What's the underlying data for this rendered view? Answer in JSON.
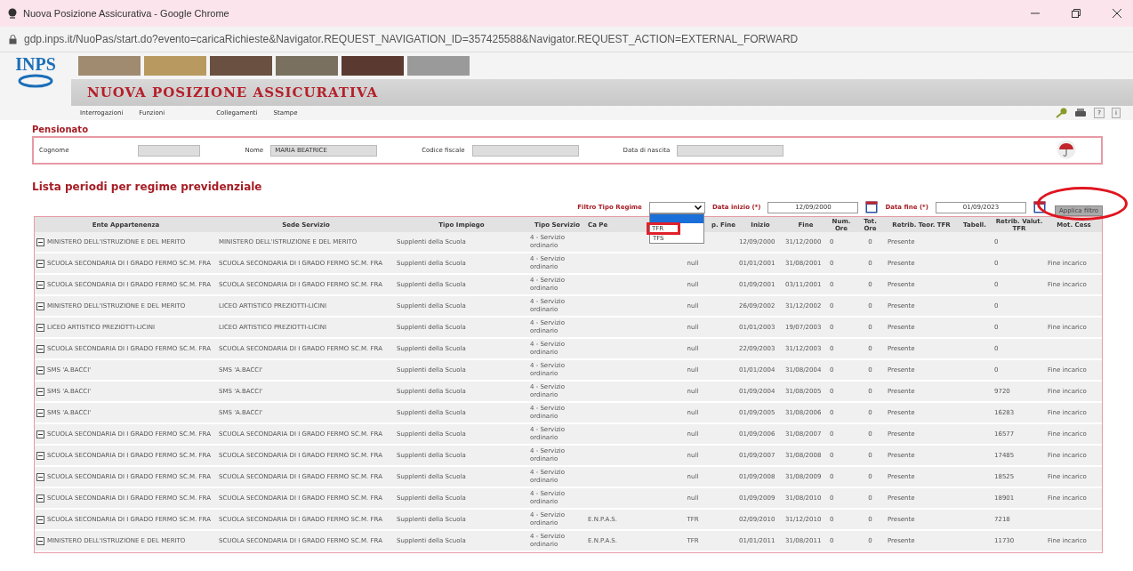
{
  "window": {
    "title": "Nuova Posizione Assicurativa - Google Chrome"
  },
  "address_bar": {
    "url": "gdp.inps.it/NuoPas/start.do?evento=caricaRichieste&Navigator.REQUEST_NAVIGATION_ID=357425588&Navigator.REQUEST_ACTION=EXTERNAL_FORWARD"
  },
  "header": {
    "logo": "INPS",
    "title": "NUOVA POSIZIONE ASSICURATIVA"
  },
  "menu": [
    "Interrogazioni",
    "Funzioni",
    "Collegamenti",
    "Stampe"
  ],
  "toolbar": {
    "help": "?",
    "info": "i"
  },
  "pensionato": {
    "title": "Pensionato",
    "fields": [
      {
        "label": "Cognome"
      },
      {
        "label": "Nome",
        "value": "MARIA BEATRICE"
      },
      {
        "label": "Codice fiscale"
      },
      {
        "label": "Data di nascita"
      }
    ]
  },
  "list_title": "Lista periodi per regime previdenziale",
  "filter": {
    "regime_label": "Filtro Tipo Regime",
    "options": [
      {
        "selected": true
      },
      {
        "label": "TFR",
        "selected": false
      },
      {
        "label": "TFS",
        "selected": false
      }
    ],
    "start_label": "Data inizio (*)",
    "start_value": "12/09/2000",
    "end_label": "Data fine (*)",
    "end_value": "01/09/2023",
    "apply": "Applica filtro"
  },
  "table": {
    "columns": [
      "Ente Appartenenza",
      "Sede Servizio",
      "Tipo Impiego",
      "Tipo Servizio",
      "Ca Pe",
      "p. Fine",
      "Inizio",
      "Fine",
      "Num. Ore",
      "Tot. Ore",
      "Retrib. Teor. TFR",
      "Tabell.",
      "Retrib. Valut. TFR",
      "Mot. Cess"
    ],
    "rows": [
      {
        "ente_appartenenza": "MINISTERO DELL'ISTRUZIONE E DEL MERITO",
        "sede_servizio": "MINISTERO DELL'ISTRUZIONE E DEL MERITO",
        "tipo_impiego": "Supplenti della Scuola",
        "tipo_servizio": "4 - Servizio ordinario",
        "inizio": "12/09/2000",
        "fine": "31/12/2000",
        "num_ore": "0",
        "tot_ore": "0",
        "retrib_teor_tfr": "Presente",
        "retrib_valut_tfr": "0"
      },
      {
        "ente_appartenenza": "SCUOLA SECONDARIA DI I GRADO FERMO SC.M. FRA",
        "sede_servizio": "SCUOLA SECONDARIA DI I GRADO FERMO SC.M. FRA",
        "tipo_impiego": "Supplenti della Scuola",
        "tipo_servizio": "4 - Servizio ordinario",
        "tipo_fine": "null",
        "inizio": "01/01/2001",
        "fine": "31/08/2001",
        "num_ore": "0",
        "tot_ore": "0",
        "retrib_teor_tfr": "Presente",
        "retrib_valut_tfr": "0",
        "mot_cess": "Fine incarico"
      },
      {
        "ente_appartenenza": "SCUOLA SECONDARIA DI I GRADO FERMO SC.M. FRA",
        "sede_servizio": "SCUOLA SECONDARIA DI I GRADO FERMO SC.M. FRA",
        "tipo_impiego": "Supplenti della Scuola",
        "tipo_servizio": "4 - Servizio ordinario",
        "tipo_fine": "null",
        "inizio": "01/09/2001",
        "fine": "03/11/2001",
        "num_ore": "0",
        "tot_ore": "0",
        "retrib_teor_tfr": "Presente",
        "retrib_valut_tfr": "0",
        "mot_cess": "Fine incarico"
      },
      {
        "ente_appartenenza": "MINISTERO DELL'ISTRUZIONE E DEL MERITO",
        "sede_servizio": "LICEO ARTISTICO PREZIOTTI-LICINI",
        "tipo_impiego": "Supplenti della Scuola",
        "tipo_servizio": "4 - Servizio ordinario",
        "tipo_fine": "null",
        "inizio": "26/09/2002",
        "fine": "31/12/2002",
        "num_ore": "0",
        "tot_ore": "0",
        "retrib_teor_tfr": "Presente",
        "retrib_valut_tfr": "0"
      },
      {
        "ente_appartenenza": "LICEO ARTISTICO PREZIOTTI-LICINI",
        "sede_servizio": "LICEO ARTISTICO PREZIOTTI-LICINI",
        "tipo_impiego": "Supplenti della Scuola",
        "tipo_servizio": "4 - Servizio ordinario",
        "tipo_fine": "null",
        "inizio": "01/01/2003",
        "fine": "19/07/2003",
        "num_ore": "0",
        "tot_ore": "0",
        "retrib_teor_tfr": "Presente",
        "retrib_valut_tfr": "0",
        "mot_cess": "Fine incarico"
      },
      {
        "ente_appartenenza": "SCUOLA SECONDARIA DI I GRADO FERMO SC.M. FRA",
        "sede_servizio": "SCUOLA SECONDARIA DI I GRADO FERMO SC.M. FRA",
        "tipo_impiego": "Supplenti della Scuola",
        "tipo_servizio": "4 - Servizio ordinario",
        "tipo_fine": "null",
        "inizio": "22/09/2003",
        "fine": "31/12/2003",
        "num_ore": "0",
        "tot_ore": "0",
        "retrib_teor_tfr": "Presente",
        "retrib_valut_tfr": "0"
      },
      {
        "ente_appartenenza": "SMS 'A.BACCI'",
        "sede_servizio": "SMS 'A.BACCI'",
        "tipo_impiego": "Supplenti della Scuola",
        "tipo_servizio": "4 - Servizio ordinario",
        "tipo_fine": "null",
        "inizio": "01/01/2004",
        "fine": "31/08/2004",
        "num_ore": "0",
        "tot_ore": "0",
        "retrib_teor_tfr": "Presente",
        "retrib_valut_tfr": "0",
        "mot_cess": "Fine incarico"
      },
      {
        "ente_appartenenza": "SMS 'A.BACCI'",
        "sede_servizio": "SMS 'A.BACCI'",
        "tipo_impiego": "Supplenti della Scuola",
        "tipo_servizio": "4 - Servizio ordinario",
        "tipo_fine": "null",
        "inizio": "01/09/2004",
        "fine": "31/08/2005",
        "num_ore": "0",
        "tot_ore": "0",
        "retrib_teor_tfr": "Presente",
        "retrib_valut_tfr": "9720",
        "mot_cess": "Fine incarico"
      },
      {
        "ente_appartenenza": "SMS 'A.BACCI'",
        "sede_servizio": "SMS 'A.BACCI'",
        "tipo_impiego": "Supplenti della Scuola",
        "tipo_servizio": "4 - Servizio ordinario",
        "tipo_fine": "null",
        "inizio": "01/09/2005",
        "fine": "31/08/2006",
        "num_ore": "0",
        "tot_ore": "0",
        "retrib_teor_tfr": "Presente",
        "retrib_valut_tfr": "16283",
        "mot_cess": "Fine incarico"
      },
      {
        "ente_appartenenza": "SCUOLA SECONDARIA DI I GRADO FERMO SC.M. FRA",
        "sede_servizio": "SCUOLA SECONDARIA DI I GRADO FERMO SC.M. FRA",
        "tipo_impiego": "Supplenti della Scuola",
        "tipo_servizio": "4 - Servizio ordinario",
        "tipo_fine": "null",
        "inizio": "01/09/2006",
        "fine": "31/08/2007",
        "num_ore": "0",
        "tot_ore": "0",
        "retrib_teor_tfr": "Presente",
        "retrib_valut_tfr": "16577",
        "mot_cess": "Fine incarico"
      },
      {
        "ente_appartenenza": "SCUOLA SECONDARIA DI I GRADO FERMO SC.M. FRA",
        "sede_servizio": "SCUOLA SECONDARIA DI I GRADO FERMO SC.M. FRA",
        "tipo_impiego": "Supplenti della Scuola",
        "tipo_servizio": "4 - Servizio ordinario",
        "tipo_fine": "null",
        "inizio": "01/09/2007",
        "fine": "31/08/2008",
        "num_ore": "0",
        "tot_ore": "0",
        "retrib_teor_tfr": "Presente",
        "retrib_valut_tfr": "17485",
        "mot_cess": "Fine incarico"
      },
      {
        "ente_appartenenza": "SCUOLA SECONDARIA DI I GRADO FERMO SC.M. FRA",
        "sede_servizio": "SCUOLA SECONDARIA DI I GRADO FERMO SC.M. FRA",
        "tipo_impiego": "Supplenti della Scuola",
        "tipo_servizio": "4 - Servizio ordinario",
        "tipo_fine": "null",
        "inizio": "01/09/2008",
        "fine": "31/08/2009",
        "num_ore": "0",
        "tot_ore": "0",
        "retrib_teor_tfr": "Presente",
        "retrib_valut_tfr": "18525",
        "mot_cess": "Fine incarico"
      },
      {
        "ente_appartenenza": "SCUOLA SECONDARIA DI I GRADO FERMO SC.M. FRA",
        "sede_servizio": "SCUOLA SECONDARIA DI I GRADO FERMO SC.M. FRA",
        "tipo_impiego": "Supplenti della Scuola",
        "tipo_servizio": "4 - Servizio ordinario",
        "tipo_fine": "null",
        "inizio": "01/09/2009",
        "fine": "31/08/2010",
        "num_ore": "0",
        "tot_ore": "0",
        "retrib_teor_tfr": "Presente",
        "retrib_valut_tfr": "18901",
        "mot_cess": "Fine incarico"
      },
      {
        "ente_appartenenza": "SCUOLA SECONDARIA DI I GRADO FERMO SC.M. FRA",
        "sede_servizio": "SCUOLA SECONDARIA DI I GRADO FERMO SC.M. FRA",
        "tipo_impiego": "Supplenti della Scuola",
        "tipo_servizio": "4 - Servizio ordinario",
        "cassa": "E.N.P.A.S.",
        "tipo_fine": "TFR",
        "inizio": "02/09/2010",
        "fine": "31/12/2010",
        "num_ore": "0",
        "tot_ore": "0",
        "retrib_teor_tfr": "Presente",
        "retrib_valut_tfr": "7218"
      },
      {
        "ente_appartenenza": "MINISTERO DELL'ISTRUZIONE E DEL MERITO",
        "sede_servizio": "SCUOLA SECONDARIA DI I GRADO FERMO SC.M. FRA",
        "tipo_impiego": "Supplenti della Scuola",
        "tipo_servizio": "4 - Servizio ordinario",
        "cassa": "E.N.P.A.S.",
        "tipo_fine": "TFR",
        "inizio": "01/01/2011",
        "fine": "31/08/2011",
        "num_ore": "0",
        "tot_ore": "0",
        "retrib_teor_tfr": "Presente",
        "retrib_valut_tfr": "11730",
        "mot_cess": "Fine incarico"
      }
    ]
  }
}
